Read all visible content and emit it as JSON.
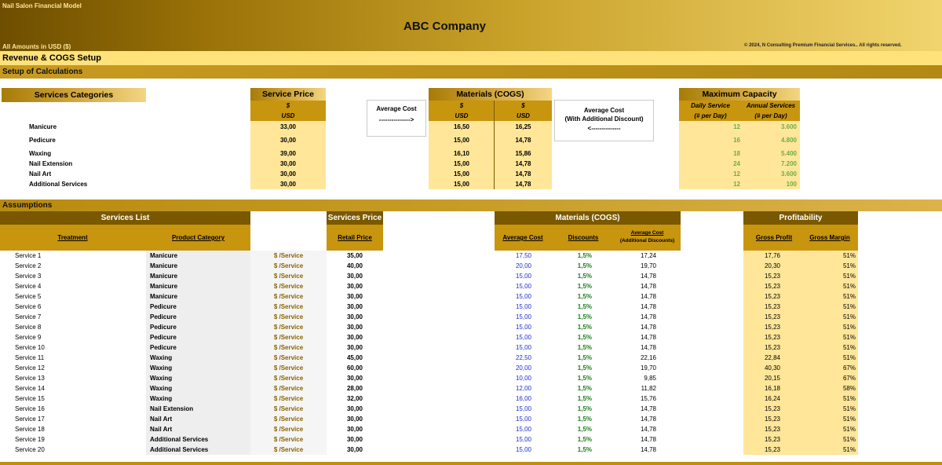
{
  "header": {
    "model_title": "Nail Salon Financial Model",
    "company": "ABC Company",
    "amounts": "All Amounts in  USD ($)",
    "copyright": "© 2024, N Consulting Premium Financial Services.. All rights reserved."
  },
  "sections": {
    "revenue_cogs": "Revenue & COGS Setup",
    "setup": "Setup of Calculations",
    "assumptions": "Assumptions"
  },
  "setup": {
    "services_categories_label": "Services Categories",
    "service_price_label": "Service Price",
    "materials_label": "Materials (COGS)",
    "max_capacity_label": "Maximum Capacity",
    "currency_symbol": "$",
    "currency_code": "USD",
    "avg_cost_label": "Average Cost",
    "avg_cost_arrow": "--------------->",
    "avg_cost_disc_label1": "Average Cost",
    "avg_cost_disc_label2": "(With Additional Discount)",
    "avg_cost_disc_arrow": "<--------------",
    "daily_service_label": "Daily Service",
    "daily_service_sub": "(# per Day)",
    "annual_services_label": "Annual Services",
    "annual_services_sub": "(# per Day)",
    "rows": [
      {
        "category": "Manicure",
        "price": "33,00",
        "avg_cost": "16,50",
        "disc_cost": "16,25",
        "daily": "12",
        "annual": "3.600"
      },
      {
        "category": "Pedicure",
        "price": "30,00",
        "avg_cost": "15,00",
        "disc_cost": "14,78",
        "daily": "16",
        "annual": "4.800"
      },
      {
        "category": "Waxing",
        "price": "39,00",
        "avg_cost": "16,10",
        "disc_cost": "15,86",
        "daily": "18",
        "annual": "5.400"
      },
      {
        "category": "Nail Extension",
        "price": "30,00",
        "avg_cost": "15,00",
        "disc_cost": "14,78",
        "daily": "24",
        "annual": "7.200"
      },
      {
        "category": "Nail Art",
        "price": "30,00",
        "avg_cost": "15,00",
        "disc_cost": "14,78",
        "daily": "12",
        "annual": "3.600"
      },
      {
        "category": "Additional Services",
        "price": "30,00",
        "avg_cost": "15,00",
        "disc_cost": "14,78",
        "daily": "12",
        "annual": "100"
      }
    ]
  },
  "assumptions": {
    "services_list_label": "Services List",
    "services_price_label": "Services Price",
    "materials_label": "Materials (COGS)",
    "profitability_label": "Profitability",
    "col_treatment": "Treatment",
    "col_product_category": "Product Category",
    "col_retail_price": "Retail Price",
    "col_average_cost": "Average Cost",
    "col_discounts": "Discounts",
    "col_avg_cost_disc1": "Average Cost",
    "col_avg_cost_disc2": "(Additional Discounts)",
    "col_gross_profit": "Gross Profit",
    "col_gross_margin": "Gross Margin",
    "unit": "$ /Service",
    "rows": [
      {
        "name": "Service 1",
        "category": "Manicure",
        "price": "35,00",
        "avg": "17,50",
        "disc": "1,5%",
        "avgd": "17,24",
        "gp": "17,76",
        "gm": "51%"
      },
      {
        "name": "Service 2",
        "category": "Manicure",
        "price": "40,00",
        "avg": "20,00",
        "disc": "1,5%",
        "avgd": "19,70",
        "gp": "20,30",
        "gm": "51%"
      },
      {
        "name": "Service 3",
        "category": "Manicure",
        "price": "30,00",
        "avg": "15,00",
        "disc": "1,5%",
        "avgd": "14,78",
        "gp": "15,23",
        "gm": "51%"
      },
      {
        "name": "Service 4",
        "category": "Manicure",
        "price": "30,00",
        "avg": "15,00",
        "disc": "1,5%",
        "avgd": "14,78",
        "gp": "15,23",
        "gm": "51%"
      },
      {
        "name": "Service 5",
        "category": "Manicure",
        "price": "30,00",
        "avg": "15,00",
        "disc": "1,5%",
        "avgd": "14,78",
        "gp": "15,23",
        "gm": "51%"
      },
      {
        "name": "Service 6",
        "category": "Pedicure",
        "price": "30,00",
        "avg": "15,00",
        "disc": "1,5%",
        "avgd": "14,78",
        "gp": "15,23",
        "gm": "51%"
      },
      {
        "name": "Service 7",
        "category": "Pedicure",
        "price": "30,00",
        "avg": "15,00",
        "disc": "1,5%",
        "avgd": "14,78",
        "gp": "15,23",
        "gm": "51%"
      },
      {
        "name": "Service 8",
        "category": "Pedicure",
        "price": "30,00",
        "avg": "15,00",
        "disc": "1,5%",
        "avgd": "14,78",
        "gp": "15,23",
        "gm": "51%"
      },
      {
        "name": "Service 9",
        "category": "Pedicure",
        "price": "30,00",
        "avg": "15,00",
        "disc": "1,5%",
        "avgd": "14,78",
        "gp": "15,23",
        "gm": "51%"
      },
      {
        "name": "Service 10",
        "category": "Pedicure",
        "price": "30,00",
        "avg": "15,00",
        "disc": "1,5%",
        "avgd": "14,78",
        "gp": "15,23",
        "gm": "51%"
      },
      {
        "name": "Service 11",
        "category": "Waxing",
        "price": "45,00",
        "avg": "22,50",
        "disc": "1,5%",
        "avgd": "22,16",
        "gp": "22,84",
        "gm": "51%"
      },
      {
        "name": "Service 12",
        "category": "Waxing",
        "price": "60,00",
        "avg": "20,00",
        "disc": "1,5%",
        "avgd": "19,70",
        "gp": "40,30",
        "gm": "67%"
      },
      {
        "name": "Service 13",
        "category": "Waxing",
        "price": "30,00",
        "avg": "10,00",
        "disc": "1,5%",
        "avgd": "9,85",
        "gp": "20,15",
        "gm": "67%"
      },
      {
        "name": "Service 14",
        "category": "Waxing",
        "price": "28,00",
        "avg": "12,00",
        "disc": "1,5%",
        "avgd": "11,82",
        "gp": "16,18",
        "gm": "58%"
      },
      {
        "name": "Service 15",
        "category": "Waxing",
        "price": "32,00",
        "avg": "16,00",
        "disc": "1,5%",
        "avgd": "15,76",
        "gp": "16,24",
        "gm": "51%"
      },
      {
        "name": "Service 16",
        "category": "Nail Extension",
        "price": "30,00",
        "avg": "15,00",
        "disc": "1,5%",
        "avgd": "14,78",
        "gp": "15,23",
        "gm": "51%"
      },
      {
        "name": "Service 17",
        "category": "Nail Art",
        "price": "30,00",
        "avg": "15,00",
        "disc": "1,5%",
        "avgd": "14,78",
        "gp": "15,23",
        "gm": "51%"
      },
      {
        "name": "Service 18",
        "category": "Nail Art",
        "price": "30,00",
        "avg": "15,00",
        "disc": "1,5%",
        "avgd": "14,78",
        "gp": "15,23",
        "gm": "51%"
      },
      {
        "name": "Service 19",
        "category": "Additional Services",
        "price": "30,00",
        "avg": "15,00",
        "disc": "1,5%",
        "avgd": "14,78",
        "gp": "15,23",
        "gm": "51%"
      },
      {
        "name": "Service 20",
        "category": "Additional Services",
        "price": "30,00",
        "avg": "15,00",
        "disc": "1,5%",
        "avgd": "14,78",
        "gp": "15,23",
        "gm": "51%"
      }
    ]
  }
}
